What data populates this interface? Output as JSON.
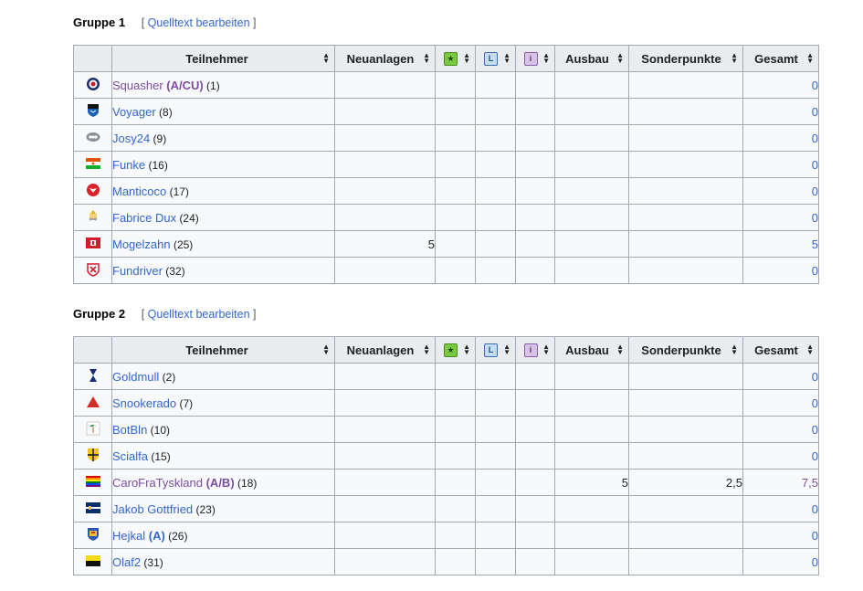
{
  "edit_link": "Quelltext bearbeiten",
  "headers": {
    "teilnehmer": "Teilnehmer",
    "neuanlagen": "Neuanlagen",
    "icon1": "star-icon",
    "icon2": "clock-icon",
    "icon3": "info-icon",
    "ausbau": "Ausbau",
    "sonderpunkte": "Sonderpunkte",
    "gesamt": "Gesamt"
  },
  "groups": [
    {
      "title": "Gruppe 1",
      "rows": [
        {
          "name": "Squasher",
          "suffix": "(A/CU)",
          "num": "(1)",
          "neuanlagen": "",
          "ausbau": "",
          "sonder": "",
          "total": "0",
          "flag": "roundel"
        },
        {
          "name": "Voyager",
          "suffix": "",
          "num": "(8)",
          "neuanlagen": "",
          "ausbau": "",
          "sonder": "",
          "total": "0",
          "flag": "shield-blue"
        },
        {
          "name": "Josy24",
          "suffix": "",
          "num": "(9)",
          "neuanlagen": "",
          "ausbau": "",
          "sonder": "",
          "total": "0",
          "flag": "gray-badge"
        },
        {
          "name": "Funke",
          "suffix": "",
          "num": "(16)",
          "neuanlagen": "",
          "ausbau": "",
          "sonder": "",
          "total": "0",
          "flag": "niger"
        },
        {
          "name": "Manticoco",
          "suffix": "",
          "num": "(17)",
          "neuanlagen": "",
          "ausbau": "",
          "sonder": "",
          "total": "0",
          "flag": "eagle-red"
        },
        {
          "name": "Fabrice Dux",
          "suffix": "",
          "num": "(24)",
          "neuanlagen": "",
          "ausbau": "",
          "sonder": "",
          "total": "0",
          "flag": "papal"
        },
        {
          "name": "Mogelzahn",
          "suffix": "",
          "num": "(25)",
          "neuanlagen": "5",
          "ausbau": "",
          "sonder": "",
          "total": "5",
          "flag": "red-white"
        },
        {
          "name": "Fundriver",
          "suffix": "",
          "num": "(32)",
          "neuanlagen": "",
          "ausbau": "",
          "sonder": "",
          "total": "0",
          "flag": "red-crest"
        }
      ]
    },
    {
      "title": "Gruppe 2",
      "rows": [
        {
          "name": "Goldmull",
          "suffix": "",
          "num": "(2)",
          "neuanlagen": "",
          "ausbau": "",
          "sonder": "",
          "total": "0",
          "flag": "navy-hourglass"
        },
        {
          "name": "Snookerado",
          "suffix": "",
          "num": "(7)",
          "neuanlagen": "",
          "ausbau": "",
          "sonder": "",
          "total": "0",
          "flag": "red-triangle"
        },
        {
          "name": "BotBln",
          "suffix": "",
          "num": "(10)",
          "neuanlagen": "",
          "ausbau": "",
          "sonder": "",
          "total": "0",
          "flag": "palm"
        },
        {
          "name": "Scialfa",
          "suffix": "",
          "num": "(15)",
          "neuanlagen": "",
          "ausbau": "",
          "sonder": "",
          "total": "0",
          "flag": "yellow-quarters"
        },
        {
          "name": "CaroFraTyskland",
          "suffix": "(A/B)",
          "num": "(18)",
          "neuanlagen": "",
          "ausbau": "5",
          "sonder": "2,5",
          "total": "7,5",
          "flag": "rainbow"
        },
        {
          "name": "Jakob Gottfried",
          "suffix": "",
          "num": "(23)",
          "neuanlagen": "",
          "ausbau": "",
          "sonder": "",
          "total": "0",
          "flag": "navy-stripe"
        },
        {
          "name": "Hejkal",
          "suffix": "(A)",
          "num": "(26)",
          "neuanlagen": "",
          "ausbau": "",
          "sonder": "",
          "total": "0",
          "flag": "crest-blue"
        },
        {
          "name": "Olaf2",
          "suffix": "",
          "num": "(31)",
          "neuanlagen": "",
          "ausbau": "",
          "sonder": "",
          "total": "0",
          "flag": "yellow-black"
        }
      ]
    }
  ],
  "colors": {
    "link": "#3366cc",
    "visited": "#7a4fa0",
    "header_bg": "#eaecf0",
    "border": "#a2a9b1"
  }
}
